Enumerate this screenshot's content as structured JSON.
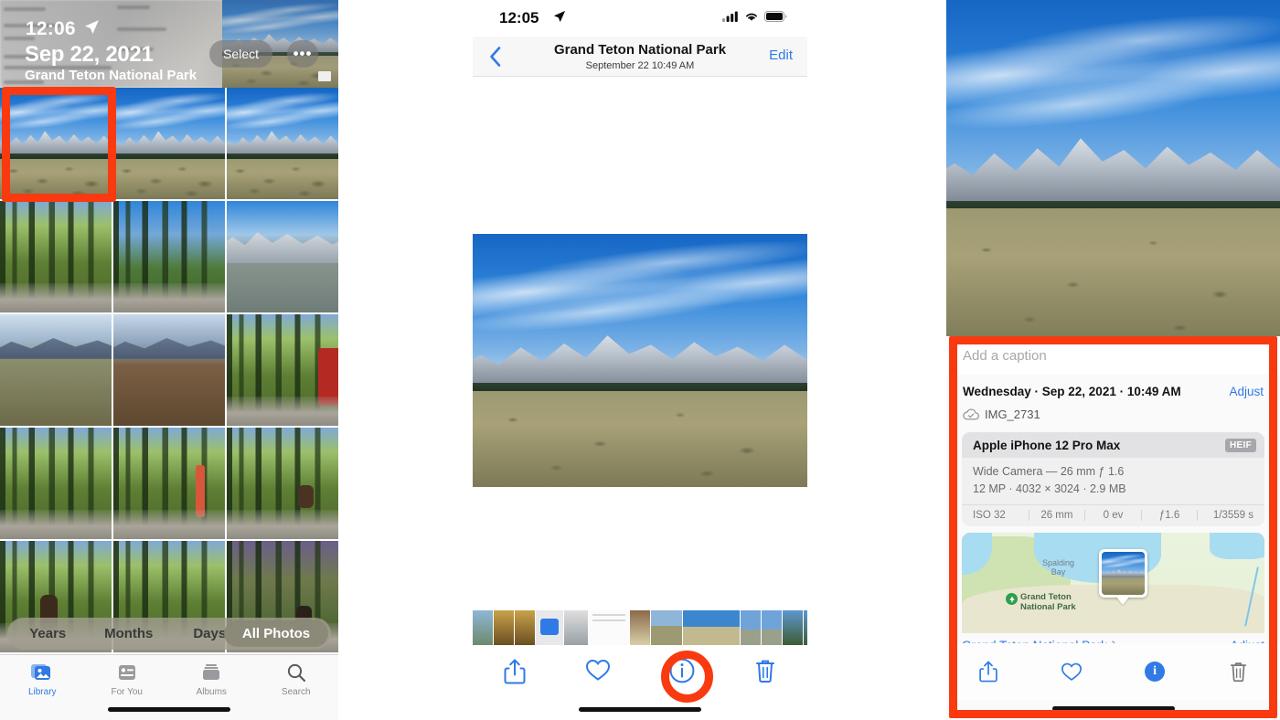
{
  "highlight_color": "#F93A10",
  "accent_blue": "#2F7AE5",
  "library_panel": {
    "status_bar": {
      "time": "12:06",
      "location_icon": "location-arrow-icon"
    },
    "header": {
      "date": "Sep 22, 2021",
      "place": "Grand Teton National Park",
      "select_label": "Select",
      "more_label": "•••"
    },
    "segmented_control": {
      "options": [
        "Years",
        "Months",
        "Days",
        "All Photos"
      ],
      "selected": "All Photos"
    },
    "tab_bar": {
      "tabs": [
        {
          "label": "Library",
          "icon": "photos-library-icon",
          "active": true
        },
        {
          "label": "For You",
          "icon": "for-you-icon",
          "active": false
        },
        {
          "label": "Albums",
          "icon": "albums-icon",
          "active": false
        },
        {
          "label": "Search",
          "icon": "search-icon",
          "active": false
        }
      ]
    },
    "grid_photos": [
      "teton-range-meadow",
      "mount-moran",
      "teton-peaks-sage",
      "forest-lake-shore",
      "pines-blue-sky",
      "jenny-lake-mountain",
      "sagebrush-butte",
      "valley-overlook",
      "forest-road-car",
      "aspen-forest-road",
      "forest-path-hiker",
      "forest-bear",
      "forest-bear-close",
      "forest-road-trees",
      "forest-dusk-bear"
    ],
    "selected_photo_index": 0
  },
  "viewer_panel": {
    "status_bar": {
      "time": "12:05",
      "location_icon": "location-arrow-icon",
      "cellular_icon": "cellular-bars-icon",
      "wifi_icon": "wifi-icon",
      "battery_icon": "battery-icon"
    },
    "nav_bar": {
      "back_icon": "chevron-left-icon",
      "title": "Grand Teton National Park",
      "subtitle": "September 22  10:49 AM",
      "edit_label": "Edit"
    },
    "photo": "teton-range-meadow-large",
    "filmstrip_count": 16,
    "toolbar": [
      {
        "name": "share-button",
        "icon": "share-icon"
      },
      {
        "name": "favorite-button",
        "icon": "heart-icon"
      },
      {
        "name": "info-button",
        "icon": "info-circle-icon",
        "highlighted": true
      },
      {
        "name": "delete-button",
        "icon": "trash-icon"
      }
    ]
  },
  "info_panel": {
    "photo": "teton-range-meadow-large",
    "caption_placeholder": "Add a caption",
    "datetime": "Wednesday · Sep 22, 2021 · 10:49 AM",
    "adjust_label": "Adjust",
    "filename": "IMG_2731",
    "cloud_icon": "icloud-check-icon",
    "device": {
      "name": "Apple iPhone 12 Pro Max",
      "format_badge": "HEIF",
      "lens": "Wide Camera — 26 mm ƒ 1.6",
      "resolution": "12 MP  ·  4032 × 3024  ·  2.9 MB",
      "exif": [
        "ISO 32",
        "26 mm",
        "0 ev",
        "ƒ1.6",
        "1/3559 s"
      ]
    },
    "map": {
      "bay_label": "Spalding\nBay",
      "park_label": "Grand Teton\nNational Park",
      "pin_icon": "park-pin-icon"
    },
    "location_link": "Grand Teton National Park",
    "location_chevron": "chevron-right-icon",
    "map_adjust_label": "Adjust",
    "toolbar": [
      {
        "name": "share-button",
        "icon": "share-icon"
      },
      {
        "name": "favorite-button",
        "icon": "heart-icon"
      },
      {
        "name": "info-button",
        "icon": "info-dot-icon",
        "active": true
      },
      {
        "name": "delete-button",
        "icon": "trash-icon"
      }
    ]
  }
}
